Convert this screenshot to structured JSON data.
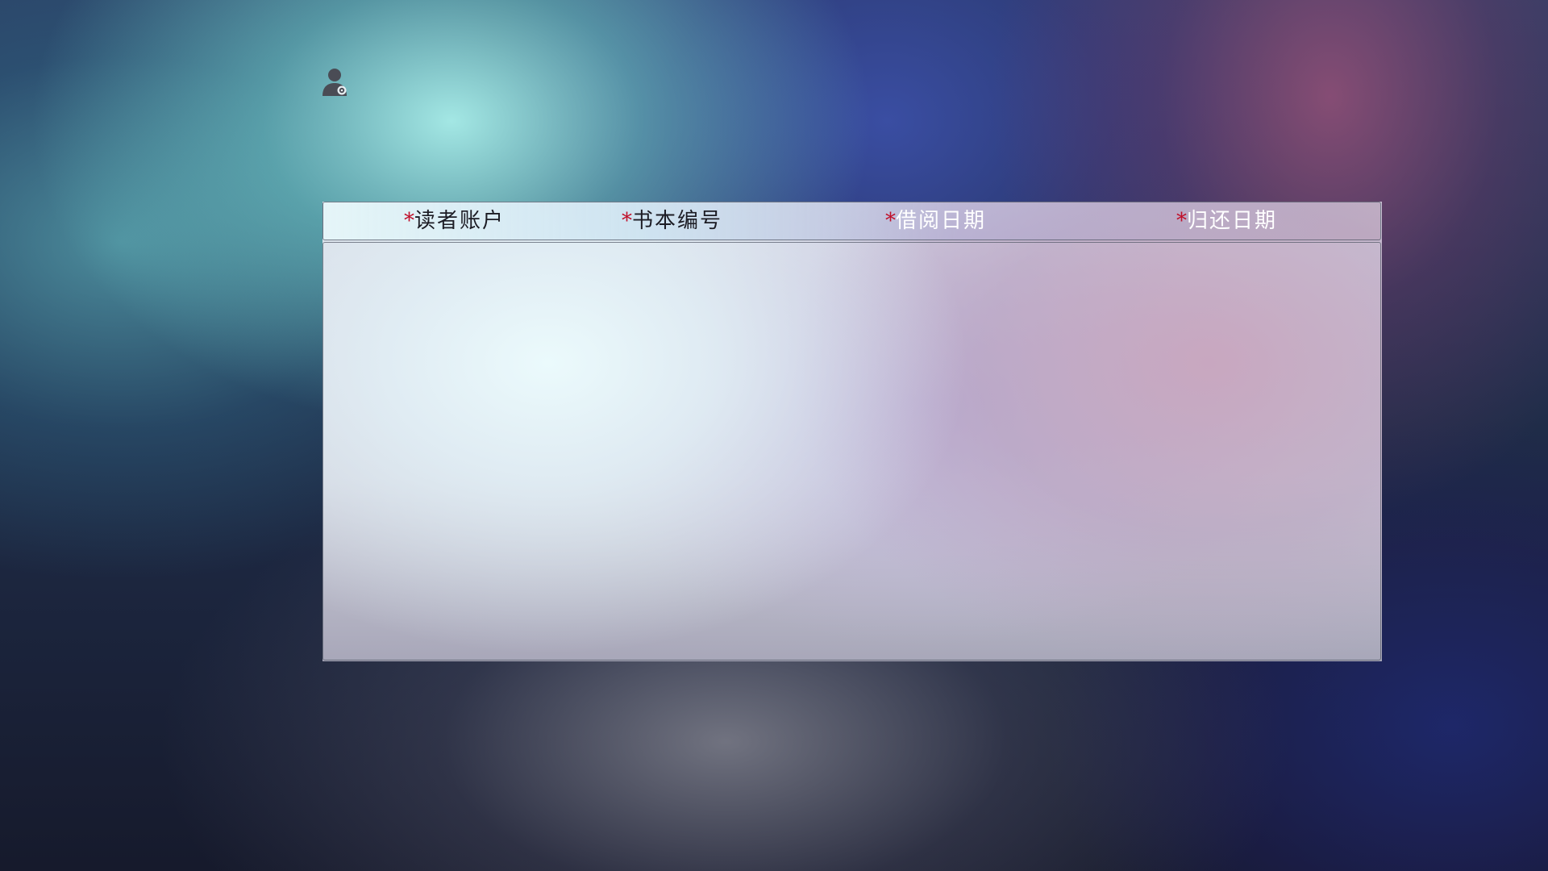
{
  "header": {
    "user_icon": "user-settings-icon"
  },
  "table": {
    "columns": [
      {
        "required_mark": "*",
        "label": "读者账户"
      },
      {
        "required_mark": "*",
        "label": "书本编号"
      },
      {
        "required_mark": "*",
        "label": "借阅日期"
      },
      {
        "required_mark": "*",
        "label": "归还日期"
      }
    ],
    "rows": []
  },
  "colors": {
    "required_mark": "#c0102a"
  }
}
